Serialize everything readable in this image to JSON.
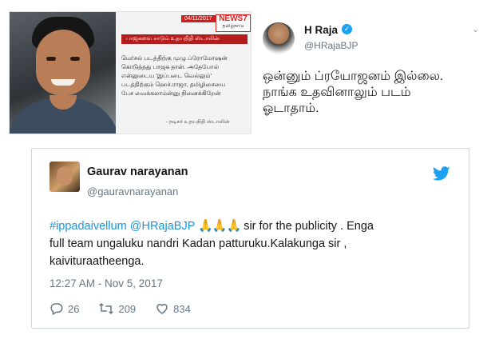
{
  "news": {
    "date": "04/11/2017",
    "logo_main": "NEWS7",
    "logo_sub": "தமிழ்நாடு",
    "headline": "பாஜகவை சாடும் உதயநிதி ஸ்டாலின்",
    "quote_lines": [
      "மெர்சல் படத்திற்கு முழு ப்ரோமோஷன்",
      "கொடுத்தது பாஜக தான். அதேபோல்",
      "என்னுடைய 'இப்படை வெல்லும்'",
      "படத்திற்கும் ஹெச்.ராஜா, தமிழிசையை",
      "பேச வைக்கலாம்ன்னு நினைக்கிறேன்"
    ],
    "signature": "- நடிகர் உதயநிதி ஸ்டாலின்"
  },
  "hraja_tweet": {
    "name": "H Raja",
    "handle": "@HRajaBJP",
    "text_lines": [
      "ஒன்னும் ப்ரயோஜனம் இல்லை.",
      "நாங்க உதவினாலும் படம்",
      "ஓடாதாம்."
    ]
  },
  "gaurav_tweet": {
    "name": "Gaurav narayanan",
    "handle": "@gauravnarayanan",
    "hashtag": "#ippadaivellum",
    "mention": "@HRajaBJP",
    "emojis": "🙏🙏🙏",
    "line1_rest": " sir for the publicity . Enga",
    "line2": "full team ungaluku nandri Kadan patturuku.Kalakunga sir ,",
    "line3": "kaivituraatheenga.",
    "timestamp": "12:27 AM - Nov 5, 2017",
    "replies": "26",
    "retweets": "209",
    "likes": "834"
  },
  "colors": {
    "link": "#1b95e0",
    "twitter_blue": "#1da1f2",
    "muted": "#657786",
    "news_red": "#b51d1d"
  }
}
